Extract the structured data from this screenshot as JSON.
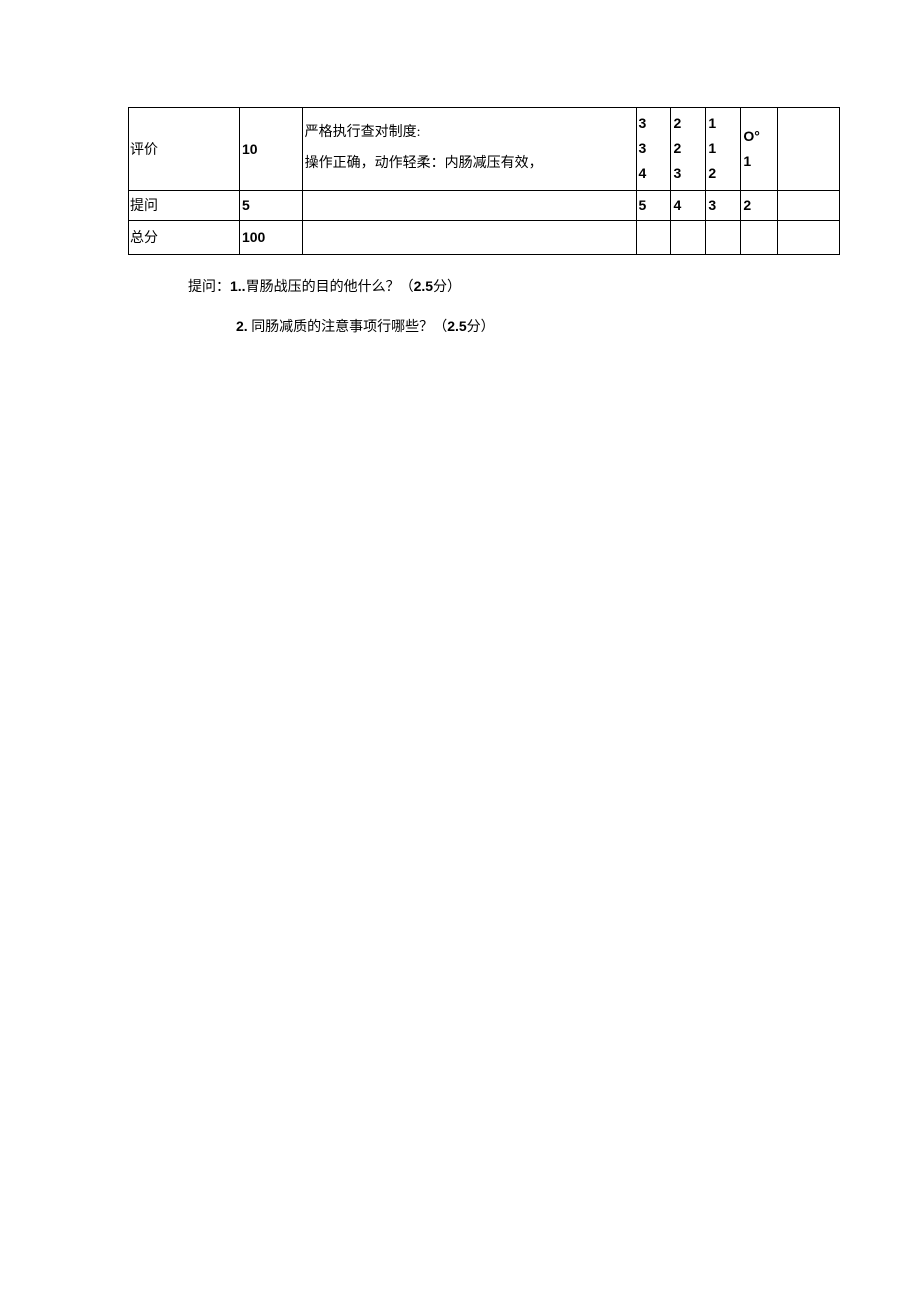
{
  "table": {
    "rows": [
      {
        "label": "评价",
        "score": "10",
        "desc": "严格执行查对制度:\n操作正确，动作轻柔：内肠减压有效，",
        "c1": "3\n3\n4",
        "c2": "2\n2\n3",
        "c3": "1\n1\n2",
        "c4": "O°\n1",
        "c5": ""
      },
      {
        "label": "提问",
        "score": "5",
        "desc": "",
        "c1": "5",
        "c2": "4",
        "c3": "3",
        "c4": "2",
        "c5": ""
      },
      {
        "label": "总分",
        "score": "100",
        "desc": "",
        "c1": "",
        "c2": "",
        "c3": "",
        "c4": "",
        "c5": ""
      }
    ]
  },
  "questions": {
    "prefix": "提问：",
    "q1_num": "1..",
    "q1_text": "胃肠战压的目的他什么？",
    "q1_points": "（",
    "q1_points_num": "2.5",
    "q1_points_suffix": "分）",
    "q2_num": "2.",
    "q2_text": " 同肠减质的注意事项行哪些？",
    "q2_points": "（",
    "q2_points_num": "2.5",
    "q2_points_suffix": "分）"
  }
}
